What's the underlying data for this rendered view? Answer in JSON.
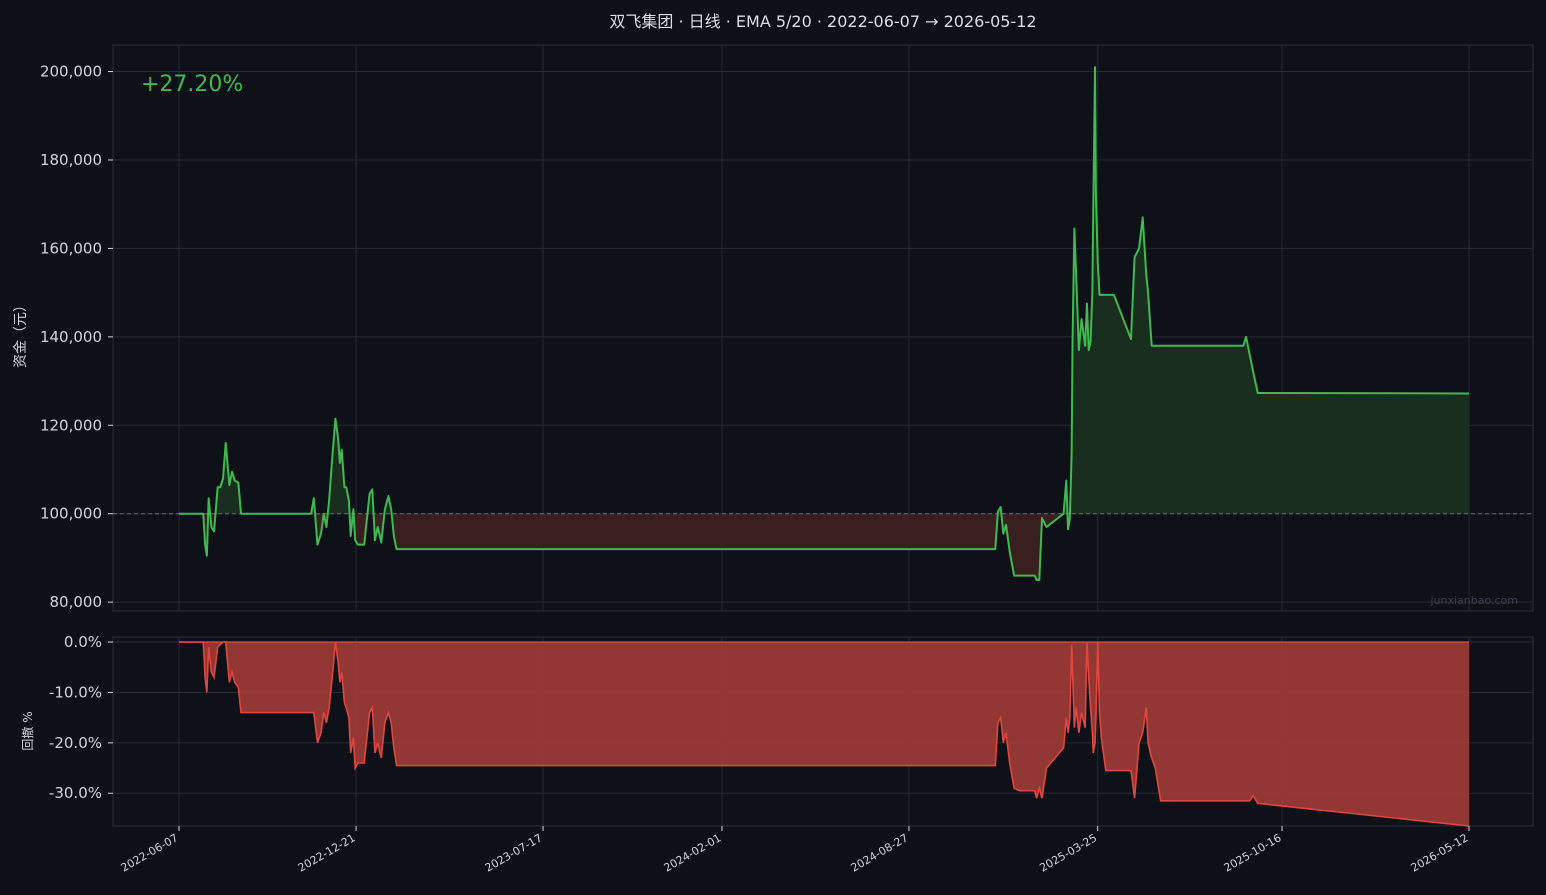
{
  "chart_data": [
    {
      "type": "line",
      "title": "双飞集团 · 日线 · EMA 5/20 · 2022-06-07 → 2026-05-12",
      "ylabel": "资金（元）",
      "ylim": [
        78000,
        206000
      ],
      "yticks": [
        "80,000",
        "100,000",
        "120,000",
        "140,000",
        "160,000",
        "180,000",
        "200,000"
      ],
      "ytick_values": [
        80000,
        100000,
        120000,
        140000,
        160000,
        180000,
        200000
      ],
      "xticks": [
        "2022-06-07",
        "2022-12-21",
        "2023-07-17",
        "2024-02-01",
        "2024-08-27",
        "2025-03-25",
        "2025-10-16",
        "2026-05-12"
      ],
      "baseline": 100000,
      "return_label": "+27.20%",
      "watermark": "junxianbao.com",
      "grid": true,
      "colors": {
        "line": "#3fba50",
        "gain_fill": "#1a2e1f",
        "loss_fill": "#3a1f20",
        "baseline": "#6b6f78"
      },
      "series": [
        {
          "x": [
            "2022-06-07",
            "2022-07-04",
            "2022-07-06",
            "2022-07-08",
            "2022-07-10",
            "2022-07-13",
            "2022-07-16",
            "2022-07-20",
            "2022-07-23",
            "2022-07-26",
            "2022-07-29",
            "2022-08-02",
            "2022-08-05",
            "2022-08-08",
            "2022-08-12",
            "2022-08-15",
            "2022-08-19",
            "2022-08-22",
            "2022-08-25",
            "2022-08-29",
            "2022-09-01",
            "2022-09-03",
            "2022-11-01",
            "2022-11-04",
            "2022-11-08",
            "2022-11-12",
            "2022-11-15",
            "2022-11-18",
            "2022-11-21",
            "2022-11-25",
            "2022-11-28",
            "2022-12-01",
            "2022-12-03",
            "2022-12-05",
            "2022-12-08",
            "2022-12-10",
            "2022-12-13",
            "2022-12-15",
            "2022-12-18",
            "2022-12-20",
            "2022-12-23",
            "2022-12-26",
            "2022-12-30",
            "2023-01-05",
            "2023-01-08",
            "2023-01-11",
            "2023-01-14",
            "2023-01-18",
            "2023-01-22",
            "2023-01-26",
            "2023-01-29",
            "2023-02-01",
            "2023-02-04",
            "2023-02-07",
            "2023-02-10",
            "2023-02-14",
            "2023-02-18",
            "2023-02-22",
            "2023-02-26",
            "2023-03-02",
            "2024-12-01",
            "2024-12-04",
            "2024-12-07",
            "2024-12-10",
            "2024-12-13",
            "2024-12-17",
            "2024-12-22",
            "2024-12-28",
            "2025-01-02",
            "2025-01-05",
            "2025-01-08",
            "2025-01-11",
            "2025-01-14",
            "2025-01-16",
            "2025-01-19",
            "2025-01-22",
            "2025-01-27",
            "2025-02-15",
            "2025-02-18",
            "2025-02-20",
            "2025-02-22",
            "2025-02-24",
            "2025-02-25",
            "2025-02-27",
            "2025-03-01",
            "2025-03-04",
            "2025-03-07",
            "2025-03-11",
            "2025-03-13",
            "2025-03-15",
            "2025-03-17",
            "2025-03-19",
            "2025-03-20",
            "2025-03-22",
            "2025-03-23",
            "2025-03-25",
            "2025-03-27",
            "2025-03-29",
            "2025-04-03",
            "2025-04-08",
            "2025-04-12",
            "2025-05-01",
            "2025-05-05",
            "2025-05-10",
            "2025-05-14",
            "2025-05-18",
            "2025-05-20",
            "2025-05-24",
            "2025-05-28",
            "2025-06-03",
            "2025-06-08",
            "2025-06-12",
            "2025-09-03",
            "2025-09-06",
            "2025-09-10",
            "2025-09-14",
            "2025-09-19",
            "2025-09-24",
            "2026-05-12"
          ],
          "values": [
            100000,
            100000,
            93000,
            90500,
            103500,
            97000,
            96000,
            106000,
            106000,
            108000,
            116000,
            106500,
            109500,
            107500,
            107000,
            100000,
            100000,
            100000,
            100000,
            100000,
            100000,
            100000,
            100000,
            103500,
            93000,
            95500,
            100000,
            97000,
            103000,
            114000,
            121500,
            117000,
            111500,
            114500,
            106000,
            106000,
            103000,
            95000,
            101000,
            94000,
            93000,
            93000,
            93000,
            104500,
            105500,
            94000,
            97000,
            93500,
            101000,
            104000,
            101000,
            95000,
            92000,
            92000,
            92000,
            92000,
            92000,
            92000,
            92000,
            92000,
            92000,
            100500,
            101500,
            95500,
            97500,
            91500,
            86000,
            86000,
            86000,
            86000,
            86000,
            86000,
            86000,
            85000,
            85000,
            99000,
            97000,
            100000,
            107500,
            96500,
            99000,
            114000,
            139000,
            164500,
            154000,
            137000,
            144000,
            138000,
            147500,
            137000,
            139000,
            150000,
            168000,
            201000,
            172000,
            157000,
            149500,
            149500,
            149500,
            149500,
            149500,
            139500,
            158000,
            160000,
            167000,
            154000,
            150000,
            138000,
            138000,
            138000,
            138000,
            138000,
            138000,
            140000,
            136000,
            132000,
            127300,
            127300,
            127200
          ]
        }
      ]
    },
    {
      "type": "area",
      "ylabel": "回撤 %",
      "ylim": [
        -36.5,
        1
      ],
      "yticks": [
        "0.0%",
        "-10.0%",
        "-20.0%",
        "-30.0%"
      ],
      "ytick_values": [
        0,
        -10,
        -20,
        -30
      ],
      "colors": {
        "line": "#e0463f",
        "fill": "#9b3a36"
      },
      "series": [
        {
          "x": [
            "2022-06-07",
            "2022-07-04",
            "2022-07-06",
            "2022-07-08",
            "2022-07-10",
            "2022-07-13",
            "2022-07-16",
            "2022-07-20",
            "2022-07-23",
            "2022-07-26",
            "2022-07-29",
            "2022-08-02",
            "2022-08-05",
            "2022-08-08",
            "2022-08-12",
            "2022-08-15",
            "2022-11-01",
            "2022-11-04",
            "2022-11-08",
            "2022-11-12",
            "2022-11-15",
            "2022-11-18",
            "2022-11-21",
            "2022-11-25",
            "2022-11-28",
            "2022-12-01",
            "2022-12-03",
            "2022-12-05",
            "2022-12-08",
            "2022-12-10",
            "2022-12-13",
            "2022-12-15",
            "2022-12-18",
            "2022-12-20",
            "2022-12-23",
            "2022-12-26",
            "2022-12-30",
            "2023-01-05",
            "2023-01-08",
            "2023-01-11",
            "2023-01-14",
            "2023-01-18",
            "2023-01-22",
            "2023-01-26",
            "2023-01-29",
            "2023-02-01",
            "2023-02-04",
            "2024-12-01",
            "2024-12-04",
            "2024-12-07",
            "2024-12-10",
            "2024-12-13",
            "2024-12-17",
            "2024-12-22",
            "2024-12-28",
            "2025-01-14",
            "2025-01-16",
            "2025-01-19",
            "2025-01-22",
            "2025-01-27",
            "2025-02-15",
            "2025-02-18",
            "2025-02-20",
            "2025-02-22",
            "2025-02-24",
            "2025-02-25",
            "2025-02-27",
            "2025-03-01",
            "2025-03-04",
            "2025-03-07",
            "2025-03-11",
            "2025-03-13",
            "2025-03-15",
            "2025-03-17",
            "2025-03-19",
            "2025-03-20",
            "2025-03-22",
            "2025-03-23",
            "2025-03-25",
            "2025-03-27",
            "2025-03-29",
            "2025-04-03",
            "2025-04-08",
            "2025-04-12",
            "2025-05-01",
            "2025-05-05",
            "2025-05-10",
            "2025-05-14",
            "2025-05-18",
            "2025-05-20",
            "2025-05-24",
            "2025-05-28",
            "2025-06-03",
            "2025-09-03",
            "2025-09-06",
            "2025-09-10",
            "2025-09-14",
            "2025-09-19",
            "2026-05-12"
          ],
          "values": [
            0,
            0,
            -7,
            -10,
            -1,
            -6,
            -7,
            -1,
            -0.5,
            0,
            0,
            -8,
            -6,
            -8,
            -9,
            -14,
            -14,
            -14,
            -20,
            -18,
            -14,
            -16,
            -13,
            -6,
            0,
            -4,
            -8,
            -6,
            -12,
            -13,
            -15,
            -22,
            -19,
            -25,
            -24,
            -24,
            -24,
            -14,
            -13,
            -22,
            -20,
            -23,
            -16,
            -14,
            -16,
            -21,
            -24.5,
            -24.5,
            -16,
            -15,
            -20,
            -18,
            -24,
            -29,
            -29.5,
            -29.5,
            -31,
            -29,
            -31,
            -25,
            -21,
            -15,
            -18,
            -15,
            -0.5,
            -6,
            -17,
            -13,
            -18,
            -14,
            -17,
            0,
            -7,
            -13,
            -18,
            -22,
            -20,
            -15,
            0,
            -14,
            -19,
            -25.5,
            -25.5,
            -25.5,
            -25.5,
            -31,
            -20,
            -18,
            -13,
            -20,
            -23,
            -25,
            -31.5,
            -31.5,
            -31.5,
            -31.5,
            -30.5,
            -32,
            -36.5
          ]
        }
      ]
    }
  ]
}
